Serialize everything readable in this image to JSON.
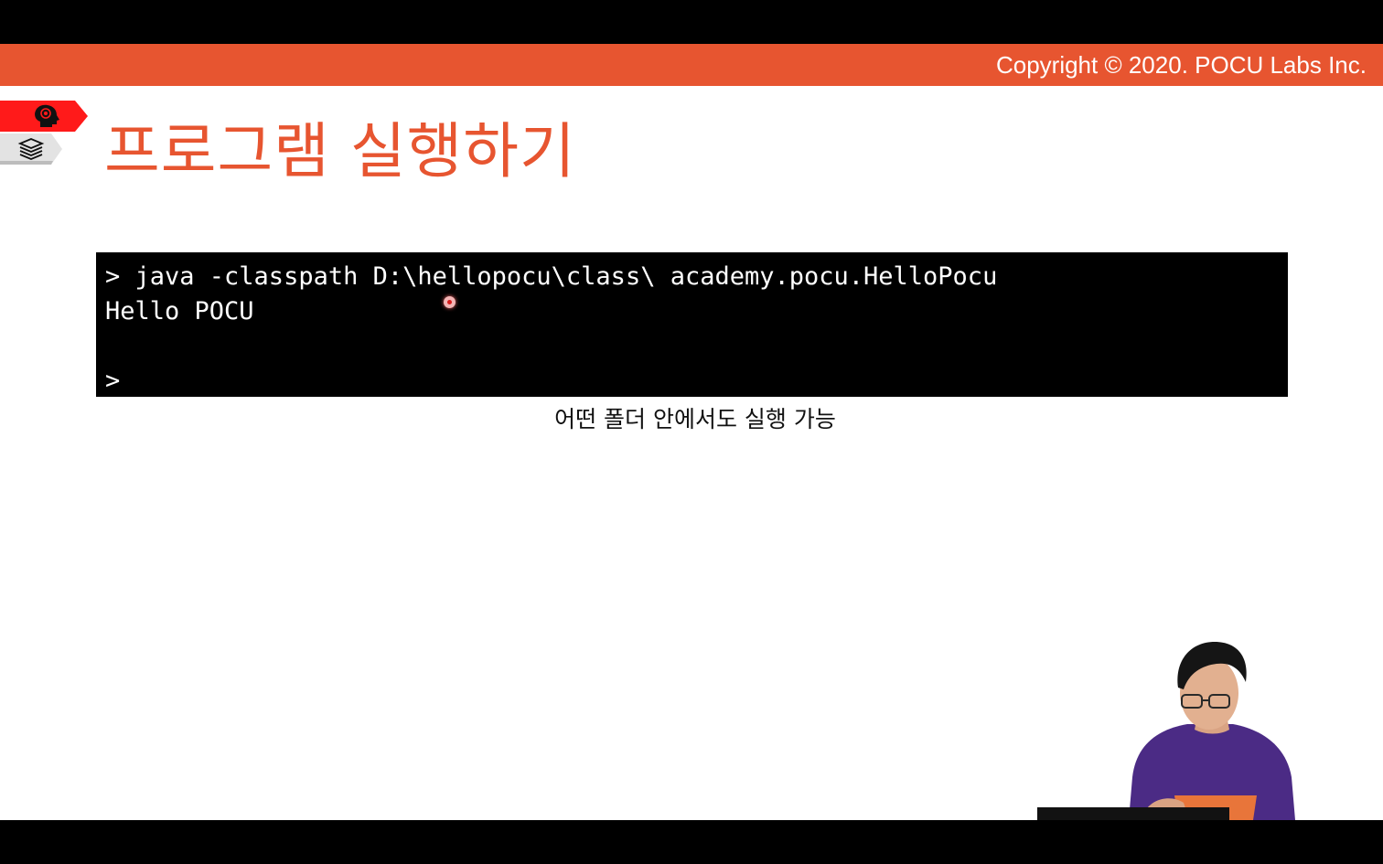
{
  "header": {
    "copyright": "Copyright © 2020. POCU Labs Inc."
  },
  "side_tabs": [
    {
      "icon": "brain-head-icon",
      "color": "#ff1a1a"
    },
    {
      "icon": "book-stack-icon",
      "color": "#e2e2e2"
    }
  ],
  "slide": {
    "title": "프로그램 실행하기",
    "caption": "어떤 폴더 안에서도 실행 가능"
  },
  "terminal": {
    "lines": [
      "> java -classpath D:\\hellopocu\\class\\ academy.pocu.HelloPocu",
      "Hello POCU",
      "",
      ">"
    ]
  },
  "colors": {
    "accent": "#e75530",
    "terminal_bg": "#000000",
    "terminal_text": "#ffffff",
    "letterbox": "#000000"
  }
}
